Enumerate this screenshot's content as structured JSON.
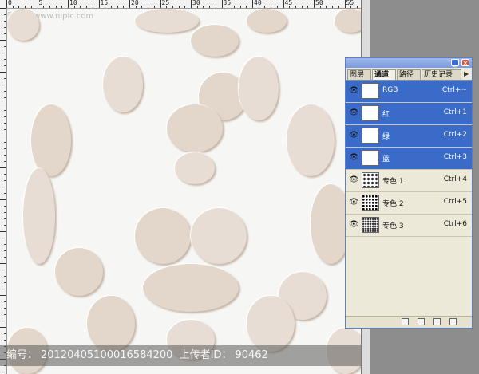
{
  "ruler": {
    "top_labels": [
      "0",
      "5",
      "10",
      "15",
      "20",
      "25",
      "30",
      "35",
      "40",
      "45",
      "50",
      "55"
    ]
  },
  "watermark": {
    "label": "编号：",
    "id": "20120405100016584200",
    "uploader_label": "上传者ID：",
    "uploader_id": "90462"
  },
  "logo_text": "昵图网 www.nipic.com",
  "panel": {
    "tabs": [
      {
        "label": "图层"
      },
      {
        "label": "通道"
      },
      {
        "label": "路径"
      },
      {
        "label": "历史记录"
      }
    ],
    "menu_glyph": "▶",
    "channels": [
      {
        "name": "RGB",
        "shortcut": "Ctrl+~",
        "selected": true,
        "thumb": "white"
      },
      {
        "name": "红",
        "shortcut": "Ctrl+1",
        "selected": true,
        "thumb": "white"
      },
      {
        "name": "绿",
        "shortcut": "Ctrl+2",
        "selected": true,
        "thumb": "white"
      },
      {
        "name": "蓝",
        "shortcut": "Ctrl+3",
        "selected": true,
        "thumb": "white"
      },
      {
        "name": "专色 1",
        "shortcut": "Ctrl+4",
        "selected": false,
        "thumb": "pattern"
      },
      {
        "name": "专色 2",
        "shortcut": "Ctrl+5",
        "selected": false,
        "thumb": "pattern2"
      },
      {
        "name": "专色 3",
        "shortcut": "Ctrl+6",
        "selected": false,
        "thumb": "pattern3"
      }
    ],
    "colors": {
      "selected_row": "#3a6bc9",
      "panel_bg": "#ece9d8",
      "titlebar": "#7a9be0"
    },
    "footer_icons": [
      "load-channel-icon",
      "save-selection-icon",
      "new-channel-icon",
      "delete-channel-icon"
    ]
  }
}
